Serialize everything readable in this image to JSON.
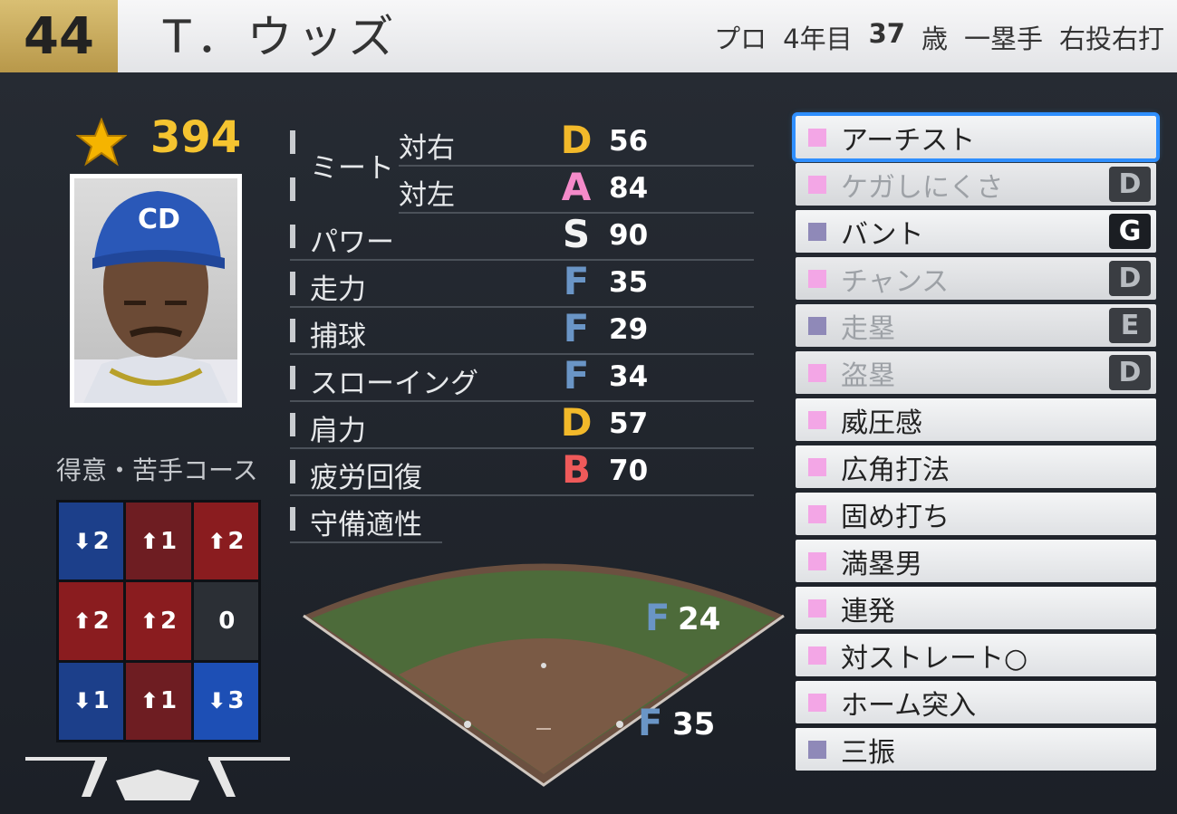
{
  "player": {
    "number": "44",
    "name": "T．ウッズ",
    "career_label": "プロ",
    "career_years": "4年目",
    "age": "37",
    "age_unit": "歳",
    "position": "一塁手",
    "throw_bat": "右投右打",
    "overall": "394"
  },
  "course": {
    "title": "得意・苦手コース",
    "cells": [
      {
        "arrow": "⬇",
        "value": "2",
        "color": "#1c3f8a"
      },
      {
        "arrow": "⬆",
        "value": "1",
        "color": "#6e1d22"
      },
      {
        "arrow": "⬆",
        "value": "2",
        "color": "#8a1c1f"
      },
      {
        "arrow": "⬆",
        "value": "2",
        "color": "#8a1c1f"
      },
      {
        "arrow": "⬆",
        "value": "2",
        "color": "#8a1c1f"
      },
      {
        "arrow": "",
        "value": "0",
        "color": "#2b2f35"
      },
      {
        "arrow": "⬇",
        "value": "1",
        "color": "#1c3f8a"
      },
      {
        "arrow": "⬆",
        "value": "1",
        "color": "#6e1d22"
      },
      {
        "arrow": "⬇",
        "value": "3",
        "color": "#1d4fb5"
      }
    ]
  },
  "stats": {
    "meet_label": "ミート",
    "rows": [
      {
        "label": "",
        "sub": "対右",
        "grade": "D",
        "value": "56",
        "color": "#f2b92a"
      },
      {
        "label": "",
        "sub": "対左",
        "grade": "A",
        "value": "84",
        "color": "#f48ac9"
      },
      {
        "label": "パワー",
        "sub": "",
        "grade": "S",
        "value": "90",
        "color": "#f3f3f3"
      },
      {
        "label": "走力",
        "sub": "",
        "grade": "F",
        "value": "35",
        "color": "#6a95c6"
      },
      {
        "label": "捕球",
        "sub": "",
        "grade": "F",
        "value": "29",
        "color": "#6a95c6"
      },
      {
        "label": "スローイング",
        "sub": "",
        "grade": "F",
        "value": "34",
        "color": "#6a95c6"
      },
      {
        "label": "肩力",
        "sub": "",
        "grade": "D",
        "value": "57",
        "color": "#f2b92a"
      },
      {
        "label": "疲労回復",
        "sub": "",
        "grade": "B",
        "value": "70",
        "color": "#ef5a5a"
      },
      {
        "label": "守備適性",
        "sub": "",
        "grade": "",
        "value": "",
        "color": "#fff"
      }
    ]
  },
  "field": {
    "first_grade": "F",
    "first_value": "24",
    "second_grade": "F",
    "second_value": "35",
    "grade_color": "#6a95c6"
  },
  "skills": [
    {
      "name": "アーチスト",
      "rank": "",
      "sq": "#f3a6e6",
      "dim": false,
      "selected": true
    },
    {
      "name": "ケガしにくさ",
      "rank": "D",
      "sq": "#f3a6e6",
      "dim": true,
      "selected": false
    },
    {
      "name": "バント",
      "rank": "G",
      "sq": "#8f89b8",
      "dim": false,
      "selected": false
    },
    {
      "name": "チャンス",
      "rank": "D",
      "sq": "#f3a6e6",
      "dim": true,
      "selected": false
    },
    {
      "name": "走塁",
      "rank": "E",
      "sq": "#8f89b8",
      "dim": true,
      "selected": false
    },
    {
      "name": "盗塁",
      "rank": "D",
      "sq": "#f3a6e6",
      "dim": true,
      "selected": false
    },
    {
      "name": "威圧感",
      "rank": "",
      "sq": "#f3a6e6",
      "dim": false,
      "selected": false
    },
    {
      "name": "広角打法",
      "rank": "",
      "sq": "#f3a6e6",
      "dim": false,
      "selected": false
    },
    {
      "name": "固め打ち",
      "rank": "",
      "sq": "#f3a6e6",
      "dim": false,
      "selected": false
    },
    {
      "name": "満塁男",
      "rank": "",
      "sq": "#f3a6e6",
      "dim": false,
      "selected": false
    },
    {
      "name": "連発",
      "rank": "",
      "sq": "#f3a6e6",
      "dim": false,
      "selected": false
    },
    {
      "name": "対ストレート○",
      "rank": "",
      "sq": "#f3a6e6",
      "dim": false,
      "selected": false
    },
    {
      "name": "ホーム突入",
      "rank": "",
      "sq": "#f3a6e6",
      "dim": false,
      "selected": false
    },
    {
      "name": "三振",
      "rank": "",
      "sq": "#8f89b8",
      "dim": false,
      "selected": false
    }
  ]
}
